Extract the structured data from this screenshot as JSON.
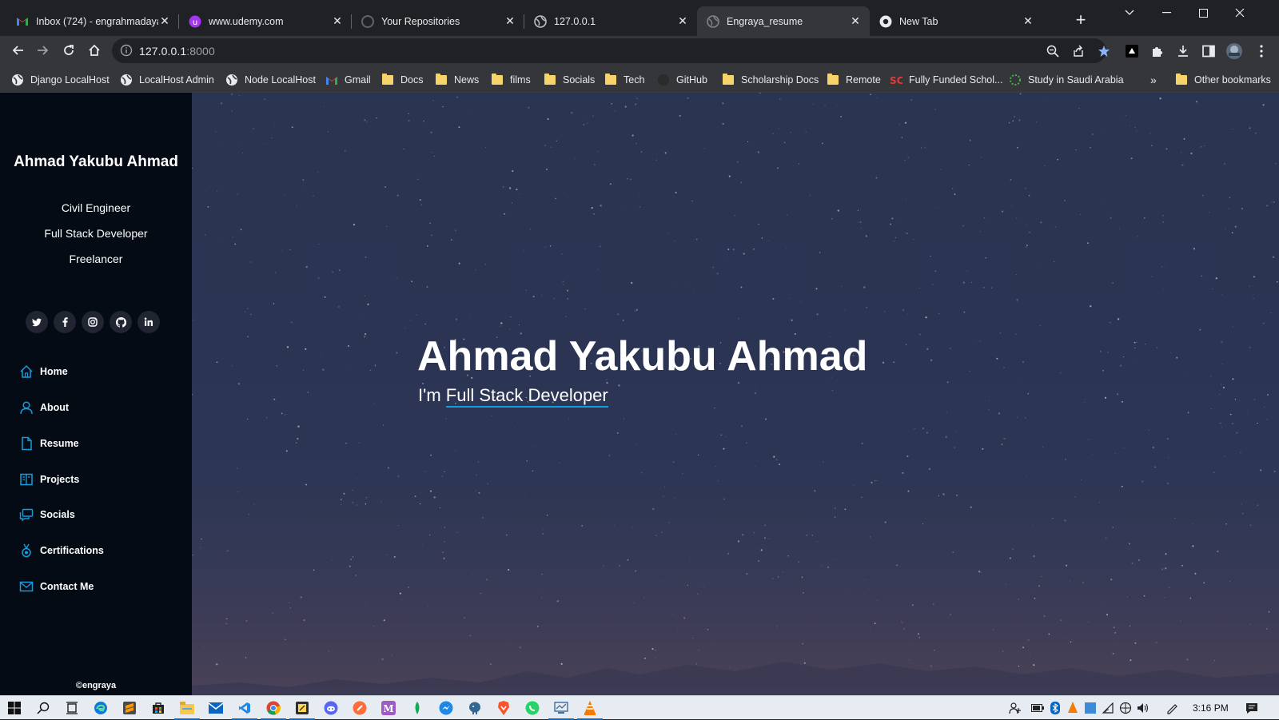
{
  "browser": {
    "tabs": [
      {
        "title": "Inbox (724) - engrahmadaya@",
        "icon": "gmail-icon",
        "active": false
      },
      {
        "title": "www.udemy.com",
        "icon": "udemy-icon",
        "active": false
      },
      {
        "title": "Your Repositories",
        "icon": "github-icon",
        "active": false
      },
      {
        "title": "127.0.0.1",
        "icon": "globe-icon",
        "active": false
      },
      {
        "title": "Engraya_resume",
        "icon": "globe-icon",
        "active": true
      },
      {
        "title": "New Tab",
        "icon": "chrome-icon",
        "active": false
      }
    ],
    "new_tab_label": "+",
    "address": {
      "host": "127.0.0.1",
      "port": ":8000"
    },
    "bookmarks": [
      {
        "label": "Django LocalHost",
        "icon": "globe-icon"
      },
      {
        "label": "LocalHost Admin",
        "icon": "globe-icon"
      },
      {
        "label": "Node LocalHost",
        "icon": "globe-icon"
      },
      {
        "label": "Gmail",
        "icon": "gmail-icon"
      },
      {
        "label": "Docs",
        "icon": "folder-icon"
      },
      {
        "label": "News",
        "icon": "folder-icon"
      },
      {
        "label": "films",
        "icon": "folder-icon"
      },
      {
        "label": "Socials",
        "icon": "folder-icon"
      },
      {
        "label": "Tech",
        "icon": "folder-icon"
      },
      {
        "label": "GitHub",
        "icon": "github-icon"
      },
      {
        "label": "Scholarship Docs",
        "icon": "folder-icon"
      },
      {
        "label": "Remote",
        "icon": "folder-icon"
      },
      {
        "label": "Fully Funded Schol...",
        "icon": "sc-icon"
      },
      {
        "label": "Study in Saudi Arabia",
        "icon": "spinner-icon"
      }
    ],
    "overflow_label": "»",
    "other_bookmarks": "Other bookmarks"
  },
  "sidebar": {
    "name": "Ahmad Yakubu Ahmad",
    "roles": [
      "Civil Engineer",
      "Full Stack Developer",
      "Freelancer"
    ],
    "socials": [
      "twitter-icon",
      "facebook-icon",
      "instagram-icon",
      "github-icon",
      "linkedin-icon"
    ],
    "nav": [
      {
        "label": "Home",
        "icon": "home-icon"
      },
      {
        "label": "About",
        "icon": "user-icon"
      },
      {
        "label": "Resume",
        "icon": "file-icon"
      },
      {
        "label": "Projects",
        "icon": "book-icon"
      },
      {
        "label": "Socials",
        "icon": "chat-icon"
      },
      {
        "label": "Certifications",
        "icon": "medal-icon"
      },
      {
        "label": "Contact Me",
        "icon": "envelope-icon"
      }
    ],
    "footer": "©engraya"
  },
  "hero": {
    "title": "Ahmad Yakubu Ahmad",
    "prefix": "I'm",
    "typed": "Full Stack Developer"
  },
  "taskbar": {
    "time": "3:16 PM"
  },
  "colors": {
    "accent": "#149ddd",
    "sidebar_bg": "#040b14",
    "hero_bg": "#2b3553"
  }
}
